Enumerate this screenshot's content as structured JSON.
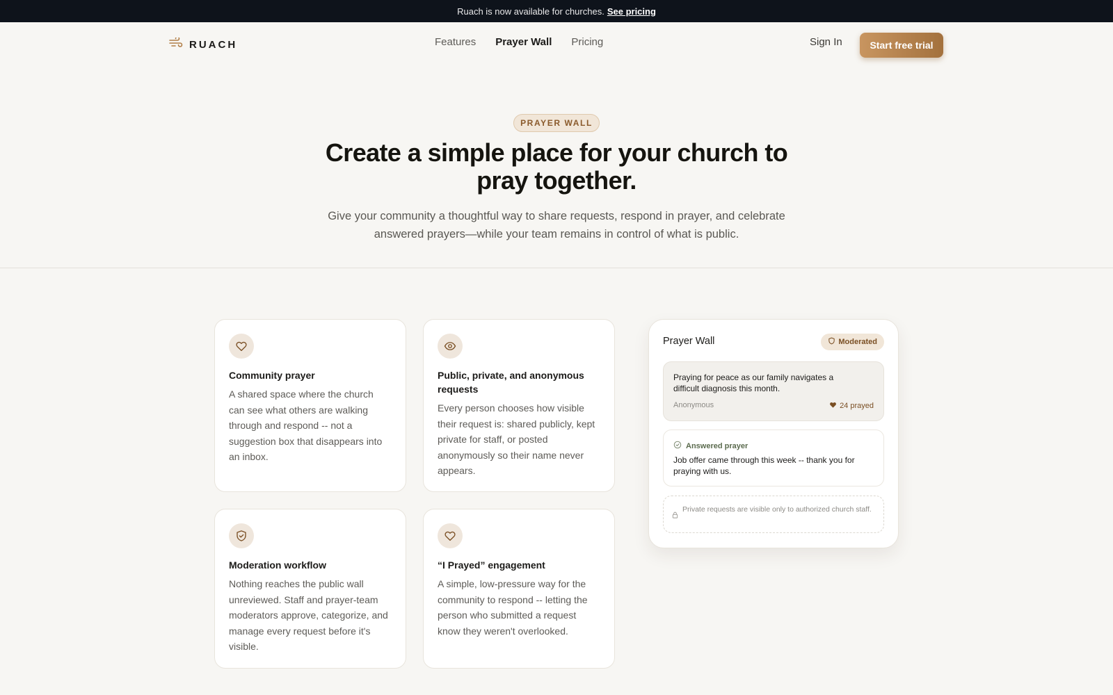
{
  "announcement": {
    "text": "Ruach is now available for churches.",
    "link": "See pricing"
  },
  "nav": {
    "brand": "RUACH",
    "links": [
      "Features",
      "Prayer Wall",
      "Pricing"
    ],
    "active_link": "Prayer Wall",
    "sign_in": "Sign In",
    "cta": "Start free trial"
  },
  "hero": {
    "eyebrow": "PRAYER WALL",
    "title_line1": "Create a simple place for your church to",
    "title_line2": "pray together.",
    "subtitle_line1": "Give your community a thoughtful way to share requests, respond in prayer, and celebrate",
    "subtitle_line2": "answered prayers—while your team remains in control of what is public."
  },
  "features": [
    {
      "icon": "heart-icon",
      "title": "Community prayer",
      "body": "A shared space where the church can see what others are walking through and respond -- not a suggestion box that disappears into an inbox."
    },
    {
      "icon": "eye-icon",
      "title": "Public, private, and anonymous requests",
      "body": "Every person chooses how visible their request is: shared publicly, kept private for staff, or posted anonymously so their name never appears."
    },
    {
      "icon": "shield-check-icon",
      "title": "Moderation workflow",
      "body": "Nothing reaches the public wall unreviewed. Staff and prayer-team moderators approve, categorize, and manage every request before it's visible."
    },
    {
      "icon": "heart-icon",
      "title": "“I Prayed” engagement",
      "body": "A simple, low-pressure way for the community to respond -- letting the person who submitted a request know they weren't overlooked."
    }
  ],
  "wall": {
    "title": "Prayer Wall",
    "badge": "Moderated",
    "request": {
      "text": "Praying for peace as our family navigates a difficult diagnosis this month.",
      "author": "Anonymous",
      "prayed": "24 prayed"
    },
    "answered": {
      "label": "Answered prayer",
      "text": "Job offer came through this week -- thank you for praying with us."
    },
    "private_note": "Private requests are visible only to authorized church staff."
  },
  "colors": {
    "accent": "#b17e47",
    "announce_bg": "#0e131b",
    "page_bg": "#f7f6f3"
  }
}
